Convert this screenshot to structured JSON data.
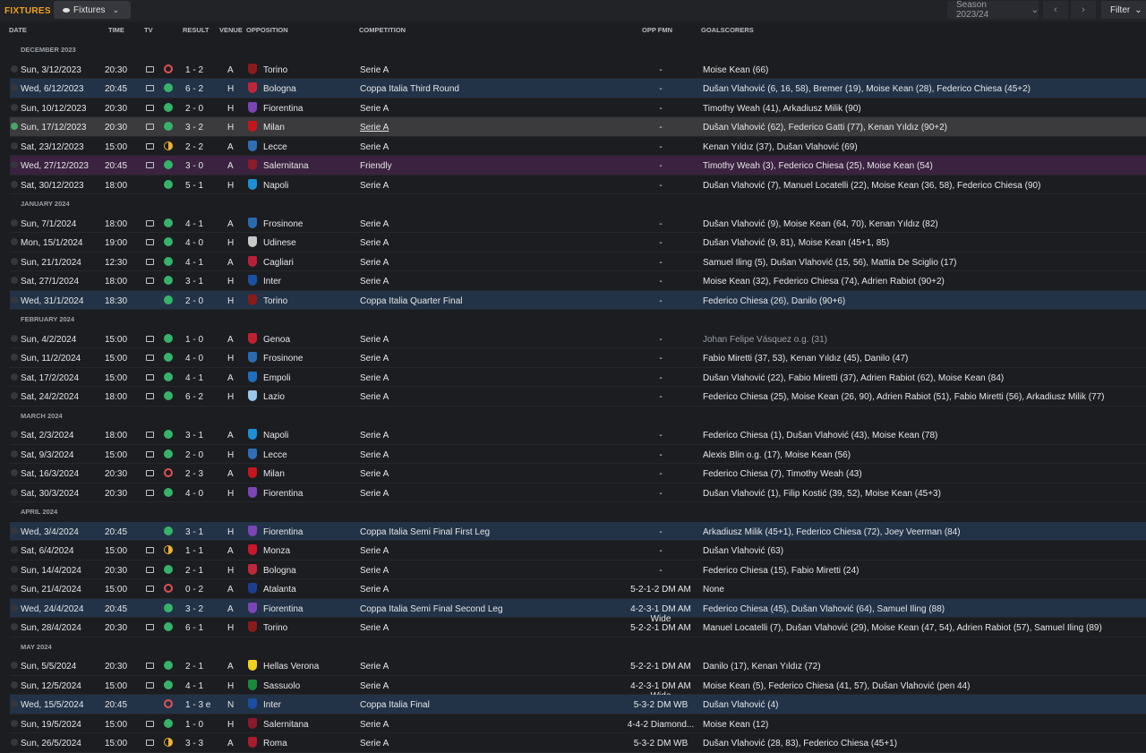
{
  "header": {
    "title": "FIXTURES",
    "view_label": "Fixtures",
    "season_label": "Season 2023/24",
    "filter_label": "Filter",
    "prev_icon": "‹",
    "next_icon": "›"
  },
  "columns": {
    "date": "DATE",
    "time": "TIME",
    "tv": "TV",
    "result": "RESULT",
    "venue": "VENUE",
    "opposition": "OPPOSITION",
    "competition": "COMPETITION",
    "opp_fmn": "OPP FMN",
    "goalscorers": "GOALSCORERS"
  },
  "colors": {
    "accent": "#f0a020",
    "win": "#36b36a",
    "loss": "#e05151",
    "draw": "#f0b030",
    "cup_row": "#223348",
    "friendly_row": "#3a2240"
  },
  "months": [
    {
      "label": "DECEMBER 2023",
      "fixtures": [
        {
          "date": "Sun, 3/12/2023",
          "time": "20:30",
          "tv": true,
          "res": "L",
          "score": "1 - 2",
          "venue": "A",
          "opp": "Torino",
          "crest": "#8b1a1a",
          "comp": "Serie A",
          "fmn": "-",
          "goals": "Moise Kean (66)",
          "type": "league",
          "done": false
        },
        {
          "date": "Wed, 6/12/2023",
          "time": "20:45",
          "tv": true,
          "res": "W",
          "score": "6 - 2",
          "venue": "H",
          "opp": "Bologna",
          "crest": "#c0263a",
          "comp": "Coppa Italia Third Round",
          "fmn": "-",
          "goals": "Dušan Vlahović (6, 16, 58), Bremer (19), Moise Kean (28), Federico Chiesa (45+2)",
          "type": "cup",
          "done": false
        },
        {
          "date": "Sun, 10/12/2023",
          "time": "20:30",
          "tv": true,
          "res": "W",
          "score": "2 - 0",
          "venue": "H",
          "opp": "Fiorentina",
          "crest": "#7b45b6",
          "comp": "Serie A",
          "fmn": "-",
          "goals": "Timothy Weah (41), Arkadiusz Milik (90)",
          "type": "league",
          "done": false
        },
        {
          "date": "Sun, 17/12/2023",
          "time": "20:30",
          "tv": true,
          "res": "W",
          "score": "3 - 2",
          "venue": "H",
          "opp": "Milan",
          "crest": "#c4161c",
          "comp": "Serie A",
          "fmn": "-",
          "goals": "Dušan Vlahović (62), Federico Gatti (77), Kenan Yıldız (90+2)",
          "type": "selected",
          "done": true
        },
        {
          "date": "Sat, 23/12/2023",
          "time": "15:00",
          "tv": true,
          "res": "D",
          "score": "2 - 2",
          "venue": "A",
          "opp": "Lecce",
          "crest": "#2f6fb8",
          "comp": "Serie A",
          "fmn": "-",
          "goals": "Kenan Yıldız (37), Dušan Vlahović (69)",
          "type": "league",
          "done": false
        },
        {
          "date": "Wed, 27/12/2023",
          "time": "20:45",
          "tv": true,
          "res": "W",
          "score": "3 - 0",
          "venue": "A",
          "opp": "Salernitana",
          "crest": "#8b1a2a",
          "comp": "Friendly",
          "fmn": "-",
          "goals": "Timothy Weah (3), Federico Chiesa (25), Moise Kean (54)",
          "type": "friendly",
          "done": false
        },
        {
          "date": "Sat, 30/12/2023",
          "time": "18:00",
          "tv": false,
          "res": "W",
          "score": "5 - 1",
          "venue": "H",
          "opp": "Napoli",
          "crest": "#1e8fd6",
          "comp": "Serie A",
          "fmn": "-",
          "goals": "Dušan Vlahović (7), Manuel Locatelli (22), Moise Kean (36, 58), Federico Chiesa (90)",
          "type": "league",
          "done": false
        }
      ]
    },
    {
      "label": "JANUARY 2024",
      "fixtures": [
        {
          "date": "Sun, 7/1/2024",
          "time": "18:00",
          "tv": true,
          "res": "W",
          "score": "4 - 1",
          "venue": "A",
          "opp": "Frosinone",
          "crest": "#2a6bb0",
          "comp": "Serie A",
          "fmn": "-",
          "goals": "Dušan Vlahović (9), Moise Kean (64, 70), Kenan Yıldız (82)",
          "type": "league",
          "done": false
        },
        {
          "date": "Mon, 15/1/2024",
          "time": "19:00",
          "tv": true,
          "res": "W",
          "score": "4 - 0",
          "venue": "H",
          "opp": "Udinese",
          "crest": "#c8c8c8",
          "comp": "Serie A",
          "fmn": "-",
          "goals": "Dušan Vlahović (9, 81), Moise Kean (45+1, 85)",
          "type": "league",
          "done": false
        },
        {
          "date": "Sun, 21/1/2024",
          "time": "12:30",
          "tv": true,
          "res": "W",
          "score": "4 - 1",
          "venue": "A",
          "opp": "Cagliari",
          "crest": "#b8203a",
          "comp": "Serie A",
          "fmn": "-",
          "goals": "Samuel Iling (5), Dušan Vlahović (15, 56), Mattia De Sciglio (17)",
          "type": "league",
          "done": false
        },
        {
          "date": "Sat, 27/1/2024",
          "time": "18:00",
          "tv": true,
          "res": "W",
          "score": "3 - 1",
          "venue": "H",
          "opp": "Inter",
          "crest": "#1c4fa0",
          "comp": "Serie A",
          "fmn": "-",
          "goals": "Moise Kean (32), Federico Chiesa (74), Adrien Rabiot (90+2)",
          "type": "league",
          "done": false
        },
        {
          "date": "Wed, 31/1/2024",
          "time": "18:30",
          "tv": false,
          "res": "W",
          "score": "2 - 0",
          "venue": "H",
          "opp": "Torino",
          "crest": "#8b1a1a",
          "comp": "Coppa Italia Quarter Final",
          "fmn": "-",
          "goals": "Federico Chiesa (26), Danilo (90+6)",
          "type": "cup",
          "done": false
        }
      ]
    },
    {
      "label": "FEBRUARY 2024",
      "fixtures": [
        {
          "date": "Sun, 4/2/2024",
          "time": "15:00",
          "tv": true,
          "res": "W",
          "score": "1 - 0",
          "venue": "A",
          "opp": "Genoa",
          "crest": "#c02030",
          "comp": "Serie A",
          "fmn": "-",
          "goals": "Johan Felipe Vásquez o.g. (31)",
          "type": "league",
          "done": false,
          "goals_muted": true
        },
        {
          "date": "Sun, 11/2/2024",
          "time": "15:00",
          "tv": true,
          "res": "W",
          "score": "4 - 0",
          "venue": "H",
          "opp": "Frosinone",
          "crest": "#2a6bb0",
          "comp": "Serie A",
          "fmn": "-",
          "goals": "Fabio Miretti (37, 53), Kenan Yıldız (45), Danilo (47)",
          "type": "league",
          "done": false
        },
        {
          "date": "Sat, 17/2/2024",
          "time": "15:00",
          "tv": true,
          "res": "W",
          "score": "4 - 1",
          "venue": "A",
          "opp": "Empoli",
          "crest": "#1f6fc0",
          "comp": "Serie A",
          "fmn": "-",
          "goals": "Dušan Vlahović (22), Fabio Miretti (37), Adrien Rabiot (62), Moise Kean (84)",
          "type": "league",
          "done": false
        },
        {
          "date": "Sat, 24/2/2024",
          "time": "18:00",
          "tv": true,
          "res": "W",
          "score": "6 - 2",
          "venue": "H",
          "opp": "Lazio",
          "crest": "#9bc7e8",
          "comp": "Serie A",
          "fmn": "-",
          "goals": "Federico Chiesa (25), Moise Kean (26, 90), Adrien Rabiot (51), Fabio Miretti (56), Arkadiusz Milik (77)",
          "type": "league",
          "done": false
        }
      ]
    },
    {
      "label": "MARCH 2024",
      "fixtures": [
        {
          "date": "Sat, 2/3/2024",
          "time": "18:00",
          "tv": true,
          "res": "W",
          "score": "3 - 1",
          "venue": "A",
          "opp": "Napoli",
          "crest": "#1e8fd6",
          "comp": "Serie A",
          "fmn": "-",
          "goals": "Federico Chiesa (1), Dušan Vlahović (43), Moise Kean (78)",
          "type": "league",
          "done": false
        },
        {
          "date": "Sat, 9/3/2024",
          "time": "15:00",
          "tv": true,
          "res": "W",
          "score": "2 - 0",
          "venue": "H",
          "opp": "Lecce",
          "crest": "#2f6fb8",
          "comp": "Serie A",
          "fmn": "-",
          "goals": "Alexis Blin o.g. (17), Moise Kean (56)",
          "type": "league",
          "done": false
        },
        {
          "date": "Sat, 16/3/2024",
          "time": "20:30",
          "tv": true,
          "res": "L",
          "score": "2 - 3",
          "venue": "A",
          "opp": "Milan",
          "crest": "#c4161c",
          "comp": "Serie A",
          "fmn": "-",
          "goals": "Federico Chiesa (7), Timothy Weah (43)",
          "type": "league",
          "done": false
        },
        {
          "date": "Sat, 30/3/2024",
          "time": "20:30",
          "tv": true,
          "res": "W",
          "score": "4 - 0",
          "venue": "H",
          "opp": "Fiorentina",
          "crest": "#7b45b6",
          "comp": "Serie A",
          "fmn": "-",
          "goals": "Dušan Vlahović (1), Filip Kostić (39, 52), Moise Kean (45+3)",
          "type": "league",
          "done": false
        }
      ]
    },
    {
      "label": "APRIL 2024",
      "fixtures": [
        {
          "date": "Wed, 3/4/2024",
          "time": "20:45",
          "tv": false,
          "res": "W",
          "score": "3 - 1",
          "venue": "H",
          "opp": "Fiorentina",
          "crest": "#7b45b6",
          "comp": "Coppa Italia Semi Final First Leg",
          "fmn": "-",
          "goals": "Arkadiusz Milik (45+1), Federico Chiesa (72), Joey Veerman (84)",
          "type": "cup",
          "done": false
        },
        {
          "date": "Sat, 6/4/2024",
          "time": "15:00",
          "tv": true,
          "res": "D",
          "score": "1 - 1",
          "venue": "A",
          "opp": "Monza",
          "crest": "#c8182a",
          "comp": "Serie A",
          "fmn": "-",
          "goals": "Dušan Vlahović (63)",
          "type": "league",
          "done": false
        },
        {
          "date": "Sun, 14/4/2024",
          "time": "20:30",
          "tv": true,
          "res": "W",
          "score": "2 - 1",
          "venue": "H",
          "opp": "Bologna",
          "crest": "#c0263a",
          "comp": "Serie A",
          "fmn": "-",
          "goals": "Federico Chiesa (15), Fabio Miretti (24)",
          "type": "league",
          "done": false
        },
        {
          "date": "Sun, 21/4/2024",
          "time": "15:00",
          "tv": true,
          "res": "L",
          "score": "0 - 2",
          "venue": "A",
          "opp": "Atalanta",
          "crest": "#1d3f8f",
          "comp": "Serie A",
          "fmn": "5-2-1-2 DM AM",
          "goals": "None",
          "type": "league",
          "done": false
        },
        {
          "date": "Wed, 24/4/2024",
          "time": "20:45",
          "tv": false,
          "res": "W",
          "score": "3 - 2",
          "venue": "A",
          "opp": "Fiorentina",
          "crest": "#7b45b6",
          "comp": "Coppa Italia Semi Final Second Leg",
          "fmn": "4-2-3-1 DM AM Wide",
          "goals": "Federico Chiesa (45), Dušan Vlahović (64), Samuel Iling (88)",
          "type": "cup",
          "done": false
        },
        {
          "date": "Sun, 28/4/2024",
          "time": "20:30",
          "tv": true,
          "res": "W",
          "score": "6 - 1",
          "venue": "H",
          "opp": "Torino",
          "crest": "#8b1a1a",
          "comp": "Serie A",
          "fmn": "5-2-2-1 DM AM",
          "goals": "Manuel Locatelli (7), Dušan Vlahović (29), Moise Kean (47, 54), Adrien Rabiot (57), Samuel Iling (89)",
          "type": "league",
          "done": false
        }
      ]
    },
    {
      "label": "MAY 2024",
      "fixtures": [
        {
          "date": "Sun, 5/5/2024",
          "time": "20:30",
          "tv": true,
          "res": "W",
          "score": "2 - 1",
          "venue": "A",
          "opp": "Hellas Verona",
          "crest": "#f0d020",
          "comp": "Serie A",
          "fmn": "5-2-2-1 DM AM",
          "goals": "Danilo (17), Kenan Yıldız (72)",
          "type": "league",
          "done": false
        },
        {
          "date": "Sun, 12/5/2024",
          "time": "15:00",
          "tv": true,
          "res": "W",
          "score": "4 - 1",
          "venue": "H",
          "opp": "Sassuolo",
          "crest": "#1a8a3a",
          "comp": "Serie A",
          "fmn": "4-2-3-1 DM AM Wide",
          "goals": "Moise Kean (5), Federico Chiesa (41, 57), Dušan Vlahović (pen 44)",
          "type": "league",
          "done": false
        },
        {
          "date": "Wed, 15/5/2024",
          "time": "20:45",
          "tv": false,
          "res": "L",
          "score": "1 - 3 e",
          "venue": "N",
          "opp": "Inter",
          "crest": "#1c4fa0",
          "comp": "Coppa Italia Final",
          "fmn": "5-3-2 DM WB",
          "goals": "Dušan Vlahović (4)",
          "type": "cup",
          "done": false
        },
        {
          "date": "Sun, 19/5/2024",
          "time": "15:00",
          "tv": true,
          "res": "W",
          "score": "1 - 0",
          "venue": "H",
          "opp": "Salernitana",
          "crest": "#8b1a2a",
          "comp": "Serie A",
          "fmn": "4-4-2 Diamond...",
          "goals": "Moise Kean (12)",
          "type": "league",
          "done": false
        },
        {
          "date": "Sun, 26/5/2024",
          "time": "15:00",
          "tv": true,
          "res": "D",
          "score": "3 - 3",
          "venue": "A",
          "opp": "Roma",
          "crest": "#a81c2c",
          "comp": "Serie A",
          "fmn": "5-3-2 DM WB",
          "goals": "Dušan Vlahović (28, 83), Federico Chiesa (45+1)",
          "type": "league",
          "done": false
        }
      ]
    }
  ]
}
